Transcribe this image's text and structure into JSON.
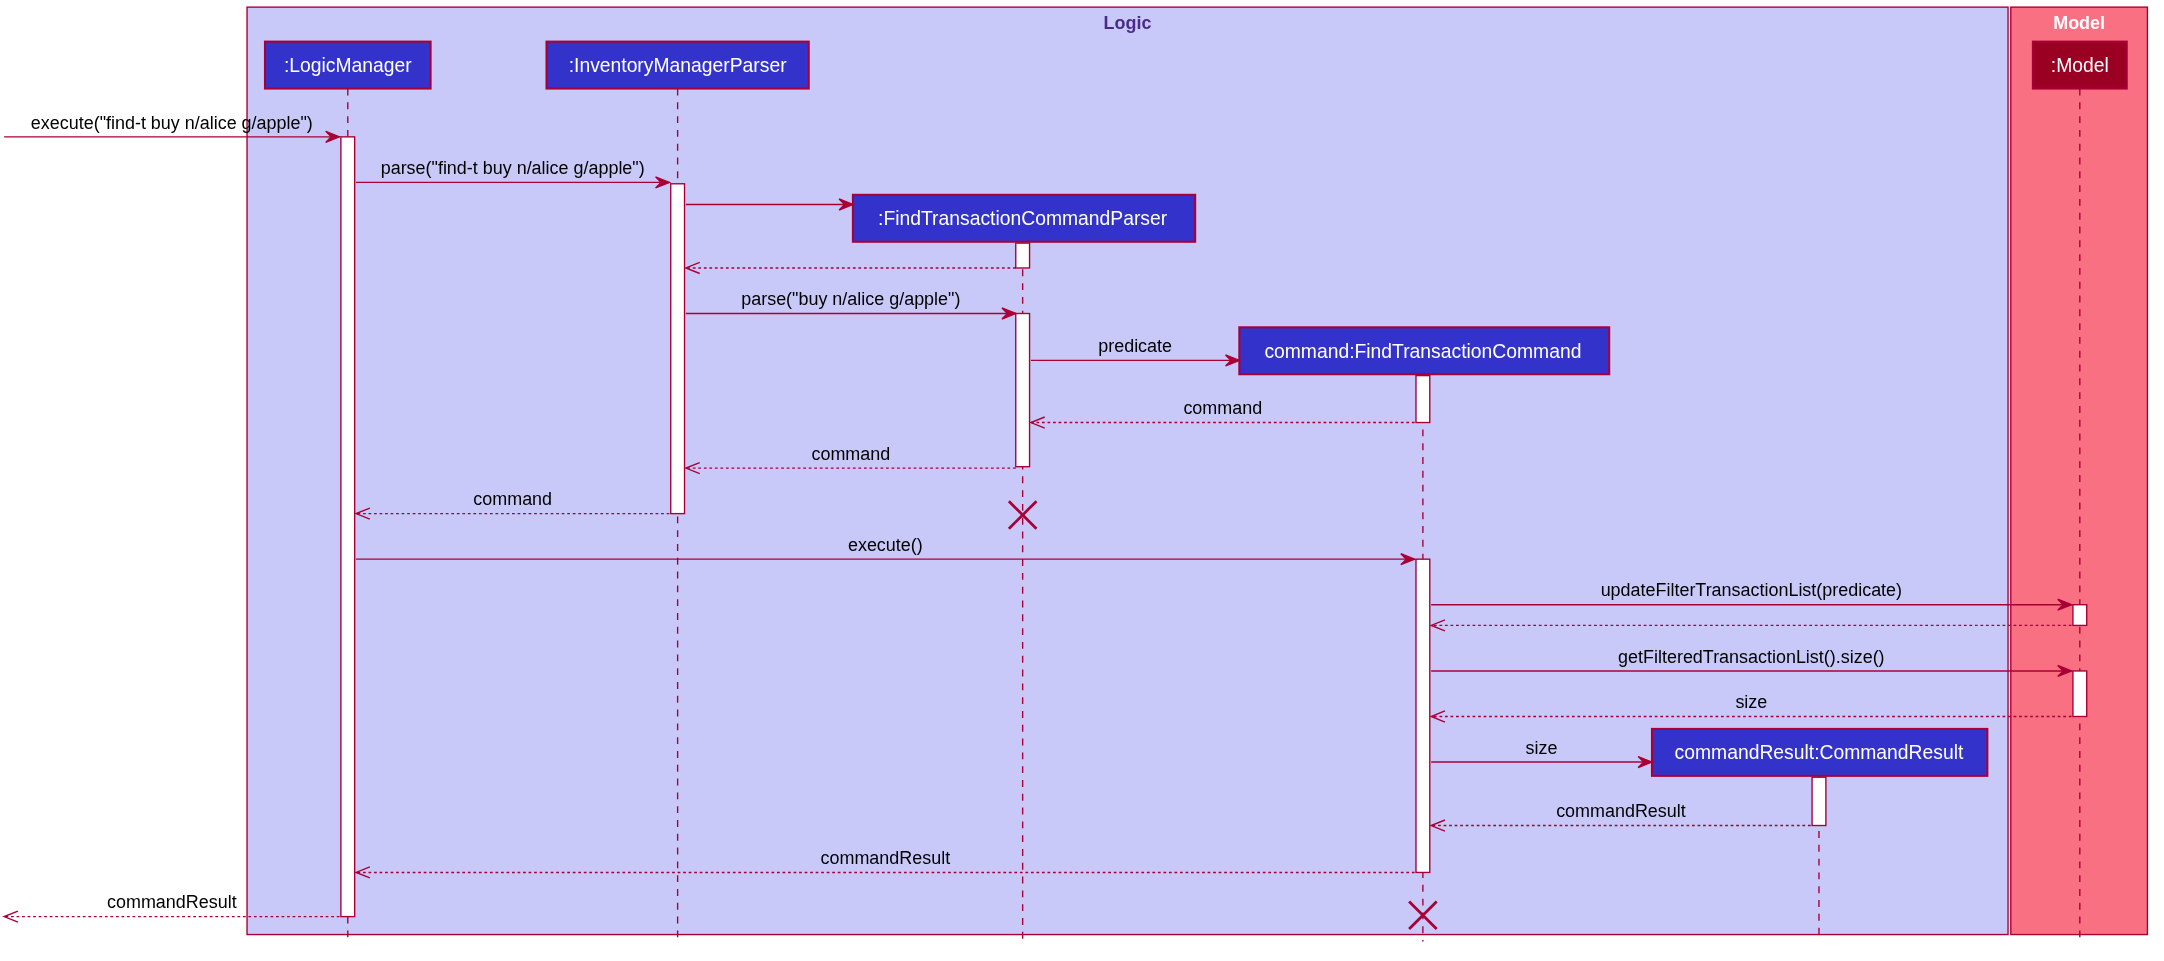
{
  "frames": [
    {
      "title": "Logic",
      "kind": "logic"
    },
    {
      "title": "Model",
      "kind": "model"
    }
  ],
  "participants": [
    {
      "label": ":LogicManager",
      "kind": "logic"
    },
    {
      "label": ":InventoryManagerParser",
      "kind": "logic"
    },
    {
      "label": ":FindTransactionCommandParser",
      "kind": "logic"
    },
    {
      "label": "command:FindTransactionCommand",
      "kind": "logic"
    },
    {
      "label": "commandResult:CommandResult",
      "kind": "logic"
    },
    {
      "label": ":Model",
      "kind": "model"
    }
  ],
  "messages": [
    {
      "label": "execute(\"find-t buy n/alice g/apple\")",
      "kind": "call"
    },
    {
      "label": "parse(\"find-t buy n/alice g/apple\")",
      "kind": "call"
    },
    {
      "kind": "create"
    },
    {
      "kind": "return"
    },
    {
      "label": "parse(\"buy n/alice g/apple\")",
      "kind": "call"
    },
    {
      "label": "predicate",
      "kind": "create"
    },
    {
      "label": "command",
      "kind": "return"
    },
    {
      "label": "command",
      "kind": "return"
    },
    {
      "label": "command",
      "kind": "return"
    },
    {
      "label": "execute()",
      "kind": "call"
    },
    {
      "label": "updateFilterTransactionList(predicate)",
      "kind": "call"
    },
    {
      "kind": "return"
    },
    {
      "label": "getFilteredTransactionList().size()",
      "kind": "call"
    },
    {
      "label": "size",
      "kind": "return"
    },
    {
      "label": "size",
      "kind": "create"
    },
    {
      "label": "commandResult",
      "kind": "return"
    },
    {
      "label": "commandResult",
      "kind": "return"
    },
    {
      "label": "commandResult",
      "kind": "return"
    }
  ]
}
